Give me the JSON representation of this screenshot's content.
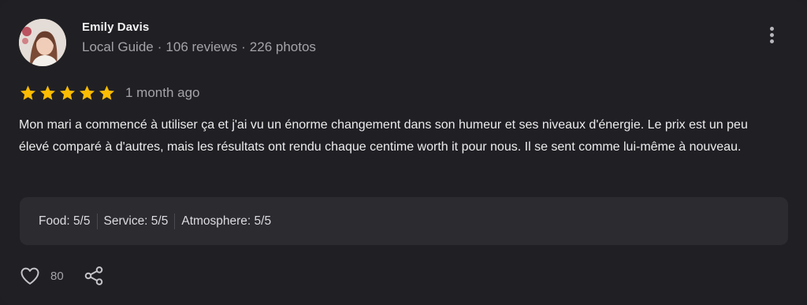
{
  "review": {
    "author": {
      "name": "Emily Davis",
      "badge": "Local Guide",
      "reviews": "106 reviews",
      "photos": "226 photos",
      "separator": "·"
    },
    "rating": 5,
    "max_rating": 5,
    "time_ago": "1 month ago",
    "text": "Mon mari a commencé à utiliser ça et j'ai vu un énorme changement dans son humeur et ses niveaux d'énergie. Le prix est un peu élevé comparé à d'autres, mais les résultats ont rendu chaque centime worth it pour nous. Il se sent comme lui-même à nouveau.",
    "details": [
      "Food: 5/5",
      "Service: 5/5",
      "Atmosphere: 5/5"
    ],
    "likes": "80"
  },
  "icons": {
    "more": "more-vert-icon",
    "star": "star-icon",
    "like": "heart-icon",
    "share": "share-icon"
  },
  "colors": {
    "card_background": "#202024",
    "star": "#fbbc04",
    "secondary_text": "#a3a3a8",
    "details_background": "#2b2b30"
  }
}
